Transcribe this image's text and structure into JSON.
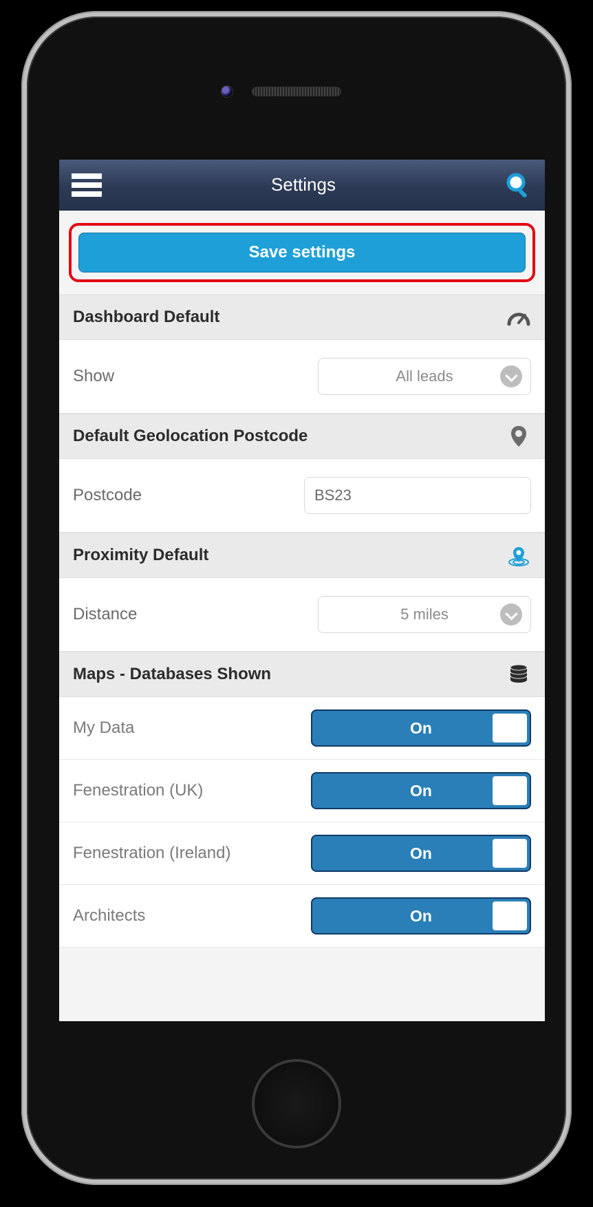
{
  "header": {
    "title": "Settings"
  },
  "save_button_label": "Save settings",
  "sections": {
    "dashboard": {
      "title": "Dashboard Default",
      "show_label": "Show",
      "show_value": "All leads"
    },
    "geolocation": {
      "title": "Default Geolocation Postcode",
      "postcode_label": "Postcode",
      "postcode_value": "BS23"
    },
    "proximity": {
      "title": "Proximity Default",
      "distance_label": "Distance",
      "distance_value": "5 miles"
    },
    "maps": {
      "title": "Maps - Databases Shown",
      "items": [
        {
          "label": "My Data",
          "state": "On"
        },
        {
          "label": "Fenestration (UK)",
          "state": "On"
        },
        {
          "label": "Fenestration (Ireland)",
          "state": "On"
        },
        {
          "label": "Architects",
          "state": "On"
        }
      ]
    }
  }
}
